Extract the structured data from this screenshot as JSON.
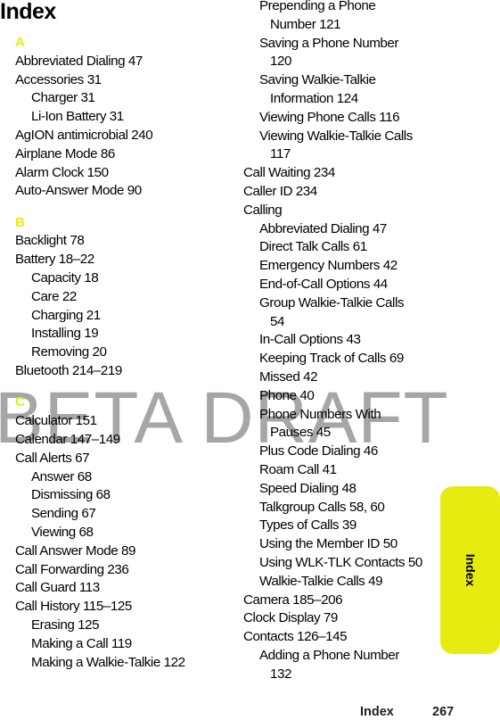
{
  "page": {
    "title": "Index",
    "watermark": "BETA DRAFT",
    "accent_color": "#e8eb0f",
    "tab_label": "Index",
    "footer": {
      "section": "Index",
      "page_number": "267"
    }
  },
  "left_column": [
    {
      "type": "letter",
      "text": "A"
    },
    {
      "type": "entry",
      "text": "Abbreviated Dialing  47"
    },
    {
      "type": "entry",
      "text": "Accessories  31"
    },
    {
      "type": "sub",
      "text": "Charger  31"
    },
    {
      "type": "sub",
      "text": "Li-Ion Battery  31"
    },
    {
      "type": "entry",
      "text": "AgION antimicrobial  240"
    },
    {
      "type": "entry",
      "text": "Airplane Mode  86"
    },
    {
      "type": "entry",
      "text": "Alarm Clock  150"
    },
    {
      "type": "entry",
      "text": "Auto-Answer Mode  90"
    },
    {
      "type": "gap"
    },
    {
      "type": "letter",
      "text": "B"
    },
    {
      "type": "entry",
      "text": "Backlight  78"
    },
    {
      "type": "entry",
      "text": "Battery  18–22"
    },
    {
      "type": "sub",
      "text": "Capacity  18"
    },
    {
      "type": "sub",
      "text": "Care  22"
    },
    {
      "type": "sub",
      "text": "Charging  21"
    },
    {
      "type": "sub",
      "text": "Installing  19"
    },
    {
      "type": "sub",
      "text": "Removing  20"
    },
    {
      "type": "entry",
      "text": "Bluetooth  214–219"
    },
    {
      "type": "gap"
    },
    {
      "type": "letter",
      "text": "C"
    },
    {
      "type": "entry",
      "text": "Calculator  151"
    },
    {
      "type": "entry",
      "text": "Calendar  147–149"
    },
    {
      "type": "entry",
      "text": "Call Alerts  67"
    },
    {
      "type": "sub",
      "text": "Answer  68"
    },
    {
      "type": "sub",
      "text": "Dismissing  68"
    },
    {
      "type": "sub",
      "text": "Sending  67"
    },
    {
      "type": "sub",
      "text": "Viewing  68"
    },
    {
      "type": "entry",
      "text": "Call Answer Mode  89"
    },
    {
      "type": "entry",
      "text": "Call Forwarding  236"
    },
    {
      "type": "entry",
      "text": "Call Guard  113"
    },
    {
      "type": "entry",
      "text": "Call History  115–125"
    },
    {
      "type": "sub",
      "text": "Erasing  125"
    },
    {
      "type": "sub",
      "text": "Making a Call  119"
    },
    {
      "type": "sub",
      "text": "Making a Walkie-Talkie  122"
    }
  ],
  "right_column": [
    {
      "type": "sub",
      "text": "Prepending a Phone"
    },
    {
      "type": "subcont",
      "text": "Number  121"
    },
    {
      "type": "sub",
      "text": "Saving a Phone Number"
    },
    {
      "type": "subcont",
      "text": "120"
    },
    {
      "type": "sub",
      "text": "Saving Walkie-Talkie"
    },
    {
      "type": "subcont",
      "text": "Information  124"
    },
    {
      "type": "sub",
      "text": "Viewing Phone Calls  116"
    },
    {
      "type": "sub",
      "text": "Viewing Walkie-Talkie Calls"
    },
    {
      "type": "subcont",
      "text": "117"
    },
    {
      "type": "entry",
      "text": "Call Waiting  234"
    },
    {
      "type": "entry",
      "text": "Caller ID  234"
    },
    {
      "type": "entry",
      "text": "Calling"
    },
    {
      "type": "sub",
      "text": "Abbreviated Dialing  47"
    },
    {
      "type": "sub",
      "text": "Direct Talk Calls  61"
    },
    {
      "type": "sub",
      "text": "Emergency Numbers  42"
    },
    {
      "type": "sub",
      "text": "End-of-Call Options  44"
    },
    {
      "type": "sub",
      "text": "Group Walkie-Talkie Calls"
    },
    {
      "type": "subcont",
      "text": "54"
    },
    {
      "type": "sub",
      "text": "In-Call Options  43"
    },
    {
      "type": "sub",
      "text": "Keeping Track of Calls  69"
    },
    {
      "type": "sub",
      "text": "Missed  42"
    },
    {
      "type": "sub",
      "text": "Phone  40"
    },
    {
      "type": "sub",
      "text": "Phone Numbers With"
    },
    {
      "type": "subcont",
      "text": "Pauses  45"
    },
    {
      "type": "sub",
      "text": "Plus Code Dialing  46"
    },
    {
      "type": "sub",
      "text": "Roam Call  41"
    },
    {
      "type": "sub",
      "text": "Speed Dialing  48"
    },
    {
      "type": "sub",
      "text": "Talkgroup Calls  58, 60"
    },
    {
      "type": "sub",
      "text": "Types of Calls  39"
    },
    {
      "type": "sub",
      "text": "Using the Member ID  50"
    },
    {
      "type": "sub",
      "text": "Using WLK-TLK Contacts  50"
    },
    {
      "type": "sub",
      "text": "Walkie-Talkie Calls  49"
    },
    {
      "type": "entry",
      "text": "Camera  185–206"
    },
    {
      "type": "entry",
      "text": "Clock Display  79"
    },
    {
      "type": "entry",
      "text": "Contacts  126–145"
    },
    {
      "type": "sub",
      "text": "Adding a Phone Number"
    },
    {
      "type": "subcont",
      "text": "132"
    }
  ]
}
